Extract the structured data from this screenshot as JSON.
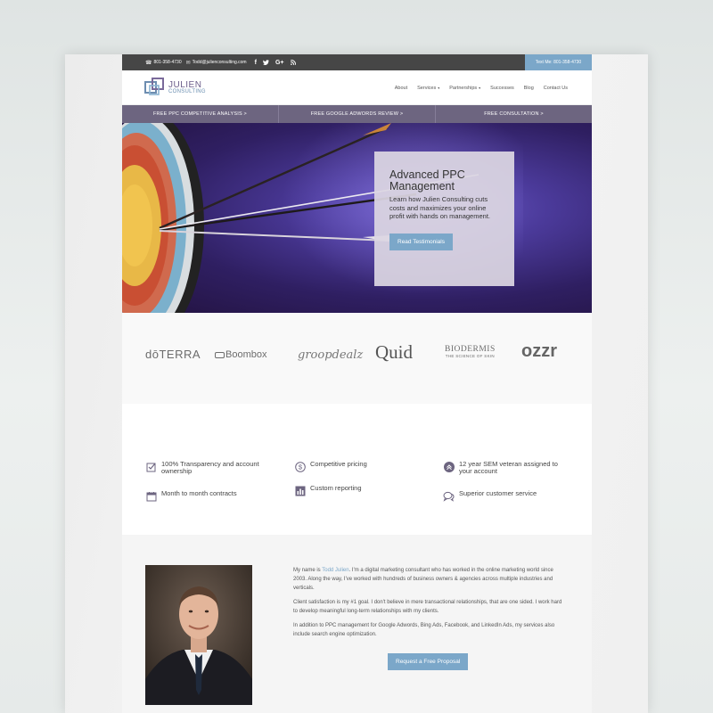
{
  "topbar": {
    "phone": "801-358-4730",
    "email": "Todd@julienconsulting.com",
    "social": [
      "f",
      "🐦",
      "G+",
      "rss"
    ],
    "text_me": "Text Me: 801-358-4730"
  },
  "logo": {
    "name": "JULIEN",
    "sub": "CONSULTING"
  },
  "nav": {
    "items": [
      "About",
      "Services",
      "Partnerships",
      "Successes",
      "Blog",
      "Contact Us"
    ]
  },
  "promo": {
    "items": [
      "FREE PPC COMPETITIVE ANALYSIS >",
      "FREE GOOGLE ADWORDS REVIEW >",
      "FREE CONSULTATION >"
    ]
  },
  "hero": {
    "title": "Advanced PPC Management",
    "body": "Learn how Julien Consulting cuts costs and maximizes your online profit with hands on management.",
    "button": "Read Testimonials"
  },
  "clients": [
    "dōTERRA",
    "Boombox",
    "groopdealz",
    "Quid",
    "BIODERMIS",
    "THE SCIENCE OF SKIN",
    "ozzr"
  ],
  "features": {
    "heading": "",
    "items": [
      "100% Transparency and account ownership",
      "Competitive pricing",
      "12 year SEM veteran assigned to your account",
      "Month to month contracts",
      "Custom reporting",
      "Superior customer service"
    ]
  },
  "about": {
    "p1_pre": "My name is ",
    "p1_link": "Todd Julien",
    "p1_post": ". I'm a digital marketing consultant who has worked in the online marketing world since 2003.  Along the way, I've worked with hundreds of business owners & agencies across multiple industries and verticals.",
    "p2": "Client satisfaction is my #1 goal. I don't believe in mere transactional relationships, that are one sided.  I work hard to develop meaningful long-term relationships with my clients.",
    "p3": "In addition to PPC management for Google Adwords, Bing Ads, Facebook, and LinkedIn Ads, my services also include search engine optimization.",
    "button": "Request a Free Proposal"
  },
  "colors": {
    "accent": "#7ba7c9",
    "purple": "#6d6580",
    "topbar": "#464646"
  }
}
